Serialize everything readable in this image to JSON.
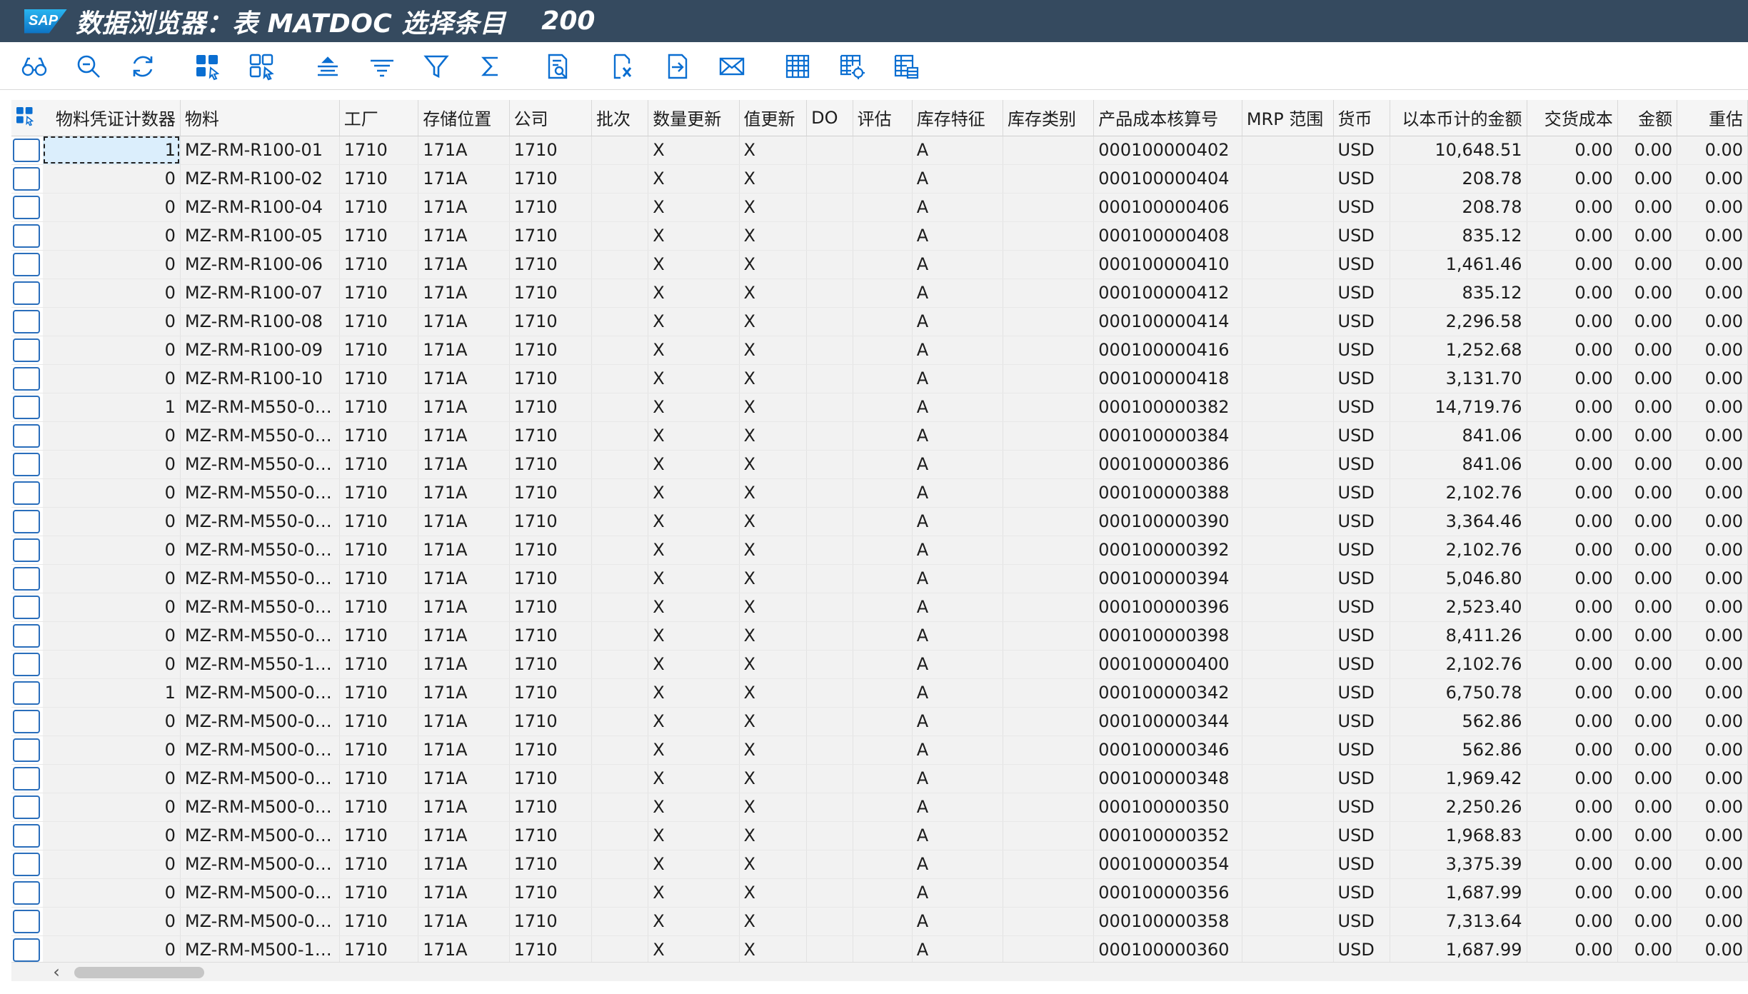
{
  "titlebar": {
    "logo_text": "SAP",
    "title": "数据浏览器：表 MATDOC 选择条目",
    "client": "200"
  },
  "toolbar": {
    "icons": [
      "glasses-icon",
      "magnifier-icon",
      "refresh-icon",
      "select-all-icon",
      "deselect-all-icon",
      "sort-ascending-icon",
      "sort-descending-icon",
      "filter-icon",
      "sum-icon",
      "details-icon",
      "export-excel-icon",
      "export-icon",
      "mail-icon",
      "layout-icon",
      "change-layout-icon",
      "select-layout-icon"
    ]
  },
  "columns": [
    "物料凭证计数器",
    "物料",
    "工厂",
    "存储位置",
    "公司",
    "批次",
    "数量更新",
    "值更新",
    "DO",
    "评估",
    "库存特征",
    "库存类别",
    "产品成本核算号",
    "MRP 范围",
    "货币",
    "以本币计的金额",
    "交货成本",
    "金额",
    "重估"
  ],
  "rows": [
    [
      "1",
      "MZ-RM-R100-01",
      "1710",
      "171A",
      "1710",
      "",
      "X",
      "X",
      "",
      "",
      "A",
      "",
      "000100000402",
      "",
      "USD",
      "10,648.51",
      "0.00",
      "0.00",
      "0.00"
    ],
    [
      "0",
      "MZ-RM-R100-02",
      "1710",
      "171A",
      "1710",
      "",
      "X",
      "X",
      "",
      "",
      "A",
      "",
      "000100000404",
      "",
      "USD",
      "208.78",
      "0.00",
      "0.00",
      "0.00"
    ],
    [
      "0",
      "MZ-RM-R100-04",
      "1710",
      "171A",
      "1710",
      "",
      "X",
      "X",
      "",
      "",
      "A",
      "",
      "000100000406",
      "",
      "USD",
      "208.78",
      "0.00",
      "0.00",
      "0.00"
    ],
    [
      "0",
      "MZ-RM-R100-05",
      "1710",
      "171A",
      "1710",
      "",
      "X",
      "X",
      "",
      "",
      "A",
      "",
      "000100000408",
      "",
      "USD",
      "835.12",
      "0.00",
      "0.00",
      "0.00"
    ],
    [
      "0",
      "MZ-RM-R100-06",
      "1710",
      "171A",
      "1710",
      "",
      "X",
      "X",
      "",
      "",
      "A",
      "",
      "000100000410",
      "",
      "USD",
      "1,461.46",
      "0.00",
      "0.00",
      "0.00"
    ],
    [
      "0",
      "MZ-RM-R100-07",
      "1710",
      "171A",
      "1710",
      "",
      "X",
      "X",
      "",
      "",
      "A",
      "",
      "000100000412",
      "",
      "USD",
      "835.12",
      "0.00",
      "0.00",
      "0.00"
    ],
    [
      "0",
      "MZ-RM-R100-08",
      "1710",
      "171A",
      "1710",
      "",
      "X",
      "X",
      "",
      "",
      "A",
      "",
      "000100000414",
      "",
      "USD",
      "2,296.58",
      "0.00",
      "0.00",
      "0.00"
    ],
    [
      "0",
      "MZ-RM-R100-09",
      "1710",
      "171A",
      "1710",
      "",
      "X",
      "X",
      "",
      "",
      "A",
      "",
      "000100000416",
      "",
      "USD",
      "1,252.68",
      "0.00",
      "0.00",
      "0.00"
    ],
    [
      "0",
      "MZ-RM-R100-10",
      "1710",
      "171A",
      "1710",
      "",
      "X",
      "X",
      "",
      "",
      "A",
      "",
      "000100000418",
      "",
      "USD",
      "3,131.70",
      "0.00",
      "0.00",
      "0.00"
    ],
    [
      "1",
      "MZ-RM-M550-0…",
      "1710",
      "171A",
      "1710",
      "",
      "X",
      "X",
      "",
      "",
      "A",
      "",
      "000100000382",
      "",
      "USD",
      "14,719.76",
      "0.00",
      "0.00",
      "0.00"
    ],
    [
      "0",
      "MZ-RM-M550-0…",
      "1710",
      "171A",
      "1710",
      "",
      "X",
      "X",
      "",
      "",
      "A",
      "",
      "000100000384",
      "",
      "USD",
      "841.06",
      "0.00",
      "0.00",
      "0.00"
    ],
    [
      "0",
      "MZ-RM-M550-0…",
      "1710",
      "171A",
      "1710",
      "",
      "X",
      "X",
      "",
      "",
      "A",
      "",
      "000100000386",
      "",
      "USD",
      "841.06",
      "0.00",
      "0.00",
      "0.00"
    ],
    [
      "0",
      "MZ-RM-M550-0…",
      "1710",
      "171A",
      "1710",
      "",
      "X",
      "X",
      "",
      "",
      "A",
      "",
      "000100000388",
      "",
      "USD",
      "2,102.76",
      "0.00",
      "0.00",
      "0.00"
    ],
    [
      "0",
      "MZ-RM-M550-0…",
      "1710",
      "171A",
      "1710",
      "",
      "X",
      "X",
      "",
      "",
      "A",
      "",
      "000100000390",
      "",
      "USD",
      "3,364.46",
      "0.00",
      "0.00",
      "0.00"
    ],
    [
      "0",
      "MZ-RM-M550-0…",
      "1710",
      "171A",
      "1710",
      "",
      "X",
      "X",
      "",
      "",
      "A",
      "",
      "000100000392",
      "",
      "USD",
      "2,102.76",
      "0.00",
      "0.00",
      "0.00"
    ],
    [
      "0",
      "MZ-RM-M550-0…",
      "1710",
      "171A",
      "1710",
      "",
      "X",
      "X",
      "",
      "",
      "A",
      "",
      "000100000394",
      "",
      "USD",
      "5,046.80",
      "0.00",
      "0.00",
      "0.00"
    ],
    [
      "0",
      "MZ-RM-M550-0…",
      "1710",
      "171A",
      "1710",
      "",
      "X",
      "X",
      "",
      "",
      "A",
      "",
      "000100000396",
      "",
      "USD",
      "2,523.40",
      "0.00",
      "0.00",
      "0.00"
    ],
    [
      "0",
      "MZ-RM-M550-0…",
      "1710",
      "171A",
      "1710",
      "",
      "X",
      "X",
      "",
      "",
      "A",
      "",
      "000100000398",
      "",
      "USD",
      "8,411.26",
      "0.00",
      "0.00",
      "0.00"
    ],
    [
      "0",
      "MZ-RM-M550-1…",
      "1710",
      "171A",
      "1710",
      "",
      "X",
      "X",
      "",
      "",
      "A",
      "",
      "000100000400",
      "",
      "USD",
      "2,102.76",
      "0.00",
      "0.00",
      "0.00"
    ],
    [
      "1",
      "MZ-RM-M500-0…",
      "1710",
      "171A",
      "1710",
      "",
      "X",
      "X",
      "",
      "",
      "A",
      "",
      "000100000342",
      "",
      "USD",
      "6,750.78",
      "0.00",
      "0.00",
      "0.00"
    ],
    [
      "0",
      "MZ-RM-M500-0…",
      "1710",
      "171A",
      "1710",
      "",
      "X",
      "X",
      "",
      "",
      "A",
      "",
      "000100000344",
      "",
      "USD",
      "562.86",
      "0.00",
      "0.00",
      "0.00"
    ],
    [
      "0",
      "MZ-RM-M500-0…",
      "1710",
      "171A",
      "1710",
      "",
      "X",
      "X",
      "",
      "",
      "A",
      "",
      "000100000346",
      "",
      "USD",
      "562.86",
      "0.00",
      "0.00",
      "0.00"
    ],
    [
      "0",
      "MZ-RM-M500-0…",
      "1710",
      "171A",
      "1710",
      "",
      "X",
      "X",
      "",
      "",
      "A",
      "",
      "000100000348",
      "",
      "USD",
      "1,969.42",
      "0.00",
      "0.00",
      "0.00"
    ],
    [
      "0",
      "MZ-RM-M500-0…",
      "1710",
      "171A",
      "1710",
      "",
      "X",
      "X",
      "",
      "",
      "A",
      "",
      "000100000350",
      "",
      "USD",
      "2,250.26",
      "0.00",
      "0.00",
      "0.00"
    ],
    [
      "0",
      "MZ-RM-M500-0…",
      "1710",
      "171A",
      "1710",
      "",
      "X",
      "X",
      "",
      "",
      "A",
      "",
      "000100000352",
      "",
      "USD",
      "1,968.83",
      "0.00",
      "0.00",
      "0.00"
    ],
    [
      "0",
      "MZ-RM-M500-0…",
      "1710",
      "171A",
      "1710",
      "",
      "X",
      "X",
      "",
      "",
      "A",
      "",
      "000100000354",
      "",
      "USD",
      "3,375.39",
      "0.00",
      "0.00",
      "0.00"
    ],
    [
      "0",
      "MZ-RM-M500-0…",
      "1710",
      "171A",
      "1710",
      "",
      "X",
      "X",
      "",
      "",
      "A",
      "",
      "000100000356",
      "",
      "USD",
      "1,687.99",
      "0.00",
      "0.00",
      "0.00"
    ],
    [
      "0",
      "MZ-RM-M500-0…",
      "1710",
      "171A",
      "1710",
      "",
      "X",
      "X",
      "",
      "",
      "A",
      "",
      "000100000358",
      "",
      "USD",
      "7,313.64",
      "0.00",
      "0.00",
      "0.00"
    ],
    [
      "0",
      "MZ-RM-M500-1…",
      "1710",
      "171A",
      "1710",
      "",
      "X",
      "X",
      "",
      "",
      "A",
      "",
      "000100000360",
      "",
      "USD",
      "1,687.99",
      "0.00",
      "0.00",
      "0.00"
    ]
  ],
  "scrollbar": {
    "left_arrow": "‹"
  },
  "colors": {
    "titlebar": "#354a5f",
    "icon": "#0a6ed1",
    "selection_border": "#2a6ebb",
    "focus_cell": "#dbeefc"
  }
}
